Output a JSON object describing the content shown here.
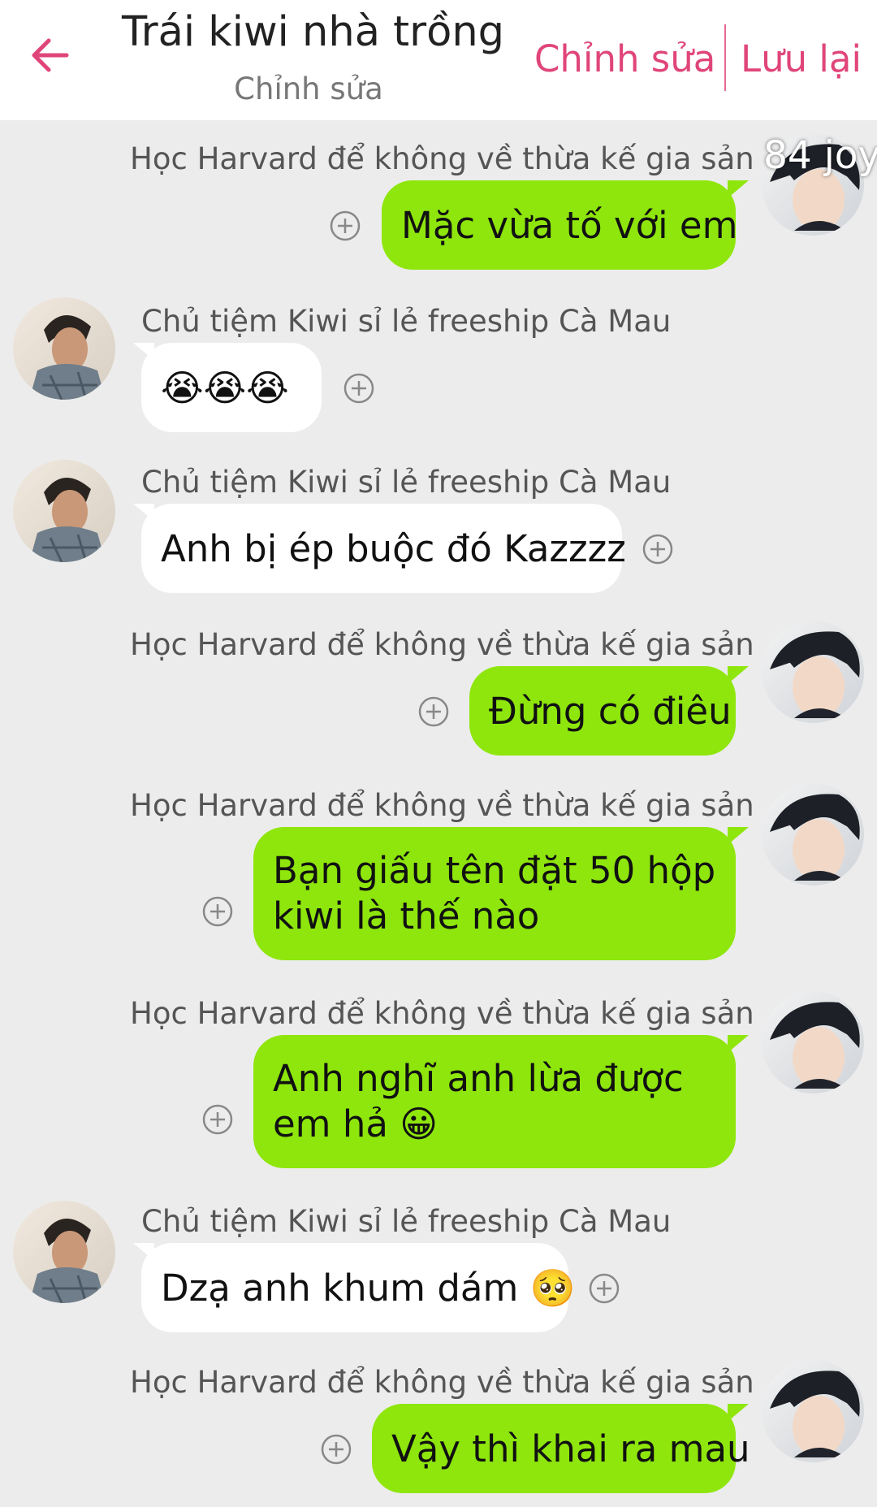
{
  "header": {
    "title": "Trái kiwi nhà trồng",
    "subtitle": "Chỉnh sửa",
    "edit_label": "Chỉnh sửa",
    "save_label": "Lưu lại",
    "accent_color": "#e0457a"
  },
  "overlay_text": "84 joy",
  "colors": {
    "sent_bubble": "#8ee60c",
    "received_bubble": "#ffffff",
    "background": "#ececec"
  },
  "messages": [
    {
      "sender": "Học Harvard để không về thừa kế gia sản",
      "side": "right",
      "text": "Mặc vừa tố với em"
    },
    {
      "sender": "Chủ tiệm Kiwi sỉ lẻ freeship Cà Mau",
      "side": "left",
      "text": "😭😭😭"
    },
    {
      "sender": "Chủ tiệm Kiwi sỉ lẻ freeship Cà Mau",
      "side": "left",
      "text": "Anh bị ép buộc đó Kazzzz"
    },
    {
      "sender": "Học Harvard để không về thừa kế gia sản",
      "side": "right",
      "text": "Đừng có điêu"
    },
    {
      "sender": "Học Harvard để không về thừa kế gia sản",
      "side": "right",
      "text_line1": "Bạn giấu tên đặt 50 hộp",
      "text_line2": "kiwi là thế nào"
    },
    {
      "sender": "Học Harvard để không về thừa kế gia sản",
      "side": "right",
      "text_line1": "Anh nghĩ anh lừa được",
      "text_line2": "em hả 😀"
    },
    {
      "sender": "Chủ tiệm Kiwi sỉ lẻ freeship Cà Mau",
      "side": "left",
      "text": "Dzạ anh khum dám 🥺"
    },
    {
      "sender": "Học Harvard để không về thừa kế gia sản",
      "side": "right",
      "text": "Vậy thì khai ra mau"
    }
  ]
}
